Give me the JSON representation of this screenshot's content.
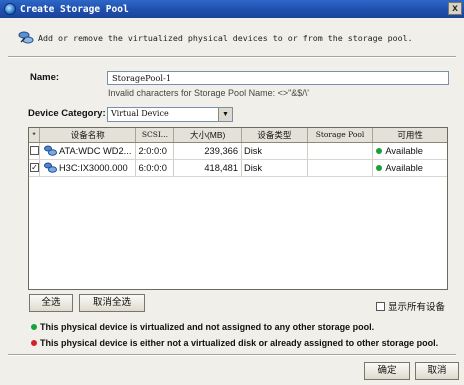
{
  "window": {
    "title": "Create Storage Pool",
    "close_glyph": "x"
  },
  "hint": "Add or remove the virtualized physical devices to or from the storage pool.",
  "form": {
    "name_label": "Name:",
    "name_value": "StoragePool-1",
    "invalid_note": "Invalid characters for Storage Pool Name: <>\"&$/\\'",
    "category_label": "Device Category:",
    "category_value": "Virtual Device",
    "category_arrow": "▼"
  },
  "table": {
    "headers": [
      "*",
      "设备名称",
      "SCSI...",
      "大小(MB)",
      "设备类型",
      "Storage Pool",
      "可用性"
    ],
    "rows": [
      {
        "checked": false,
        "name": "ATA:WDC WD2...",
        "scsi": "2:0:0:0",
        "size": "239,366",
        "type": "Disk",
        "pool": "",
        "availability": "Available"
      },
      {
        "checked": true,
        "name": "H3C:IX3000.000",
        "scsi": "6:0:0:0",
        "size": "418,481",
        "type": "Disk",
        "pool": "",
        "availability": "Available"
      }
    ]
  },
  "buttons": {
    "select_all": "全选",
    "deselect_all": "取消全选",
    "ok": "确定",
    "cancel": "取消"
  },
  "show_all_label": "显示所有设备",
  "legend": {
    "green_text": "This physical device is virtualized and not assigned to any other storage pool.",
    "red_text": "This physical device is either not a virtualized disk or already assigned to other storage pool."
  },
  "colors": {
    "titlebar": "#1f4fae",
    "available": "#19a13a",
    "unavailable": "#d8202a"
  }
}
